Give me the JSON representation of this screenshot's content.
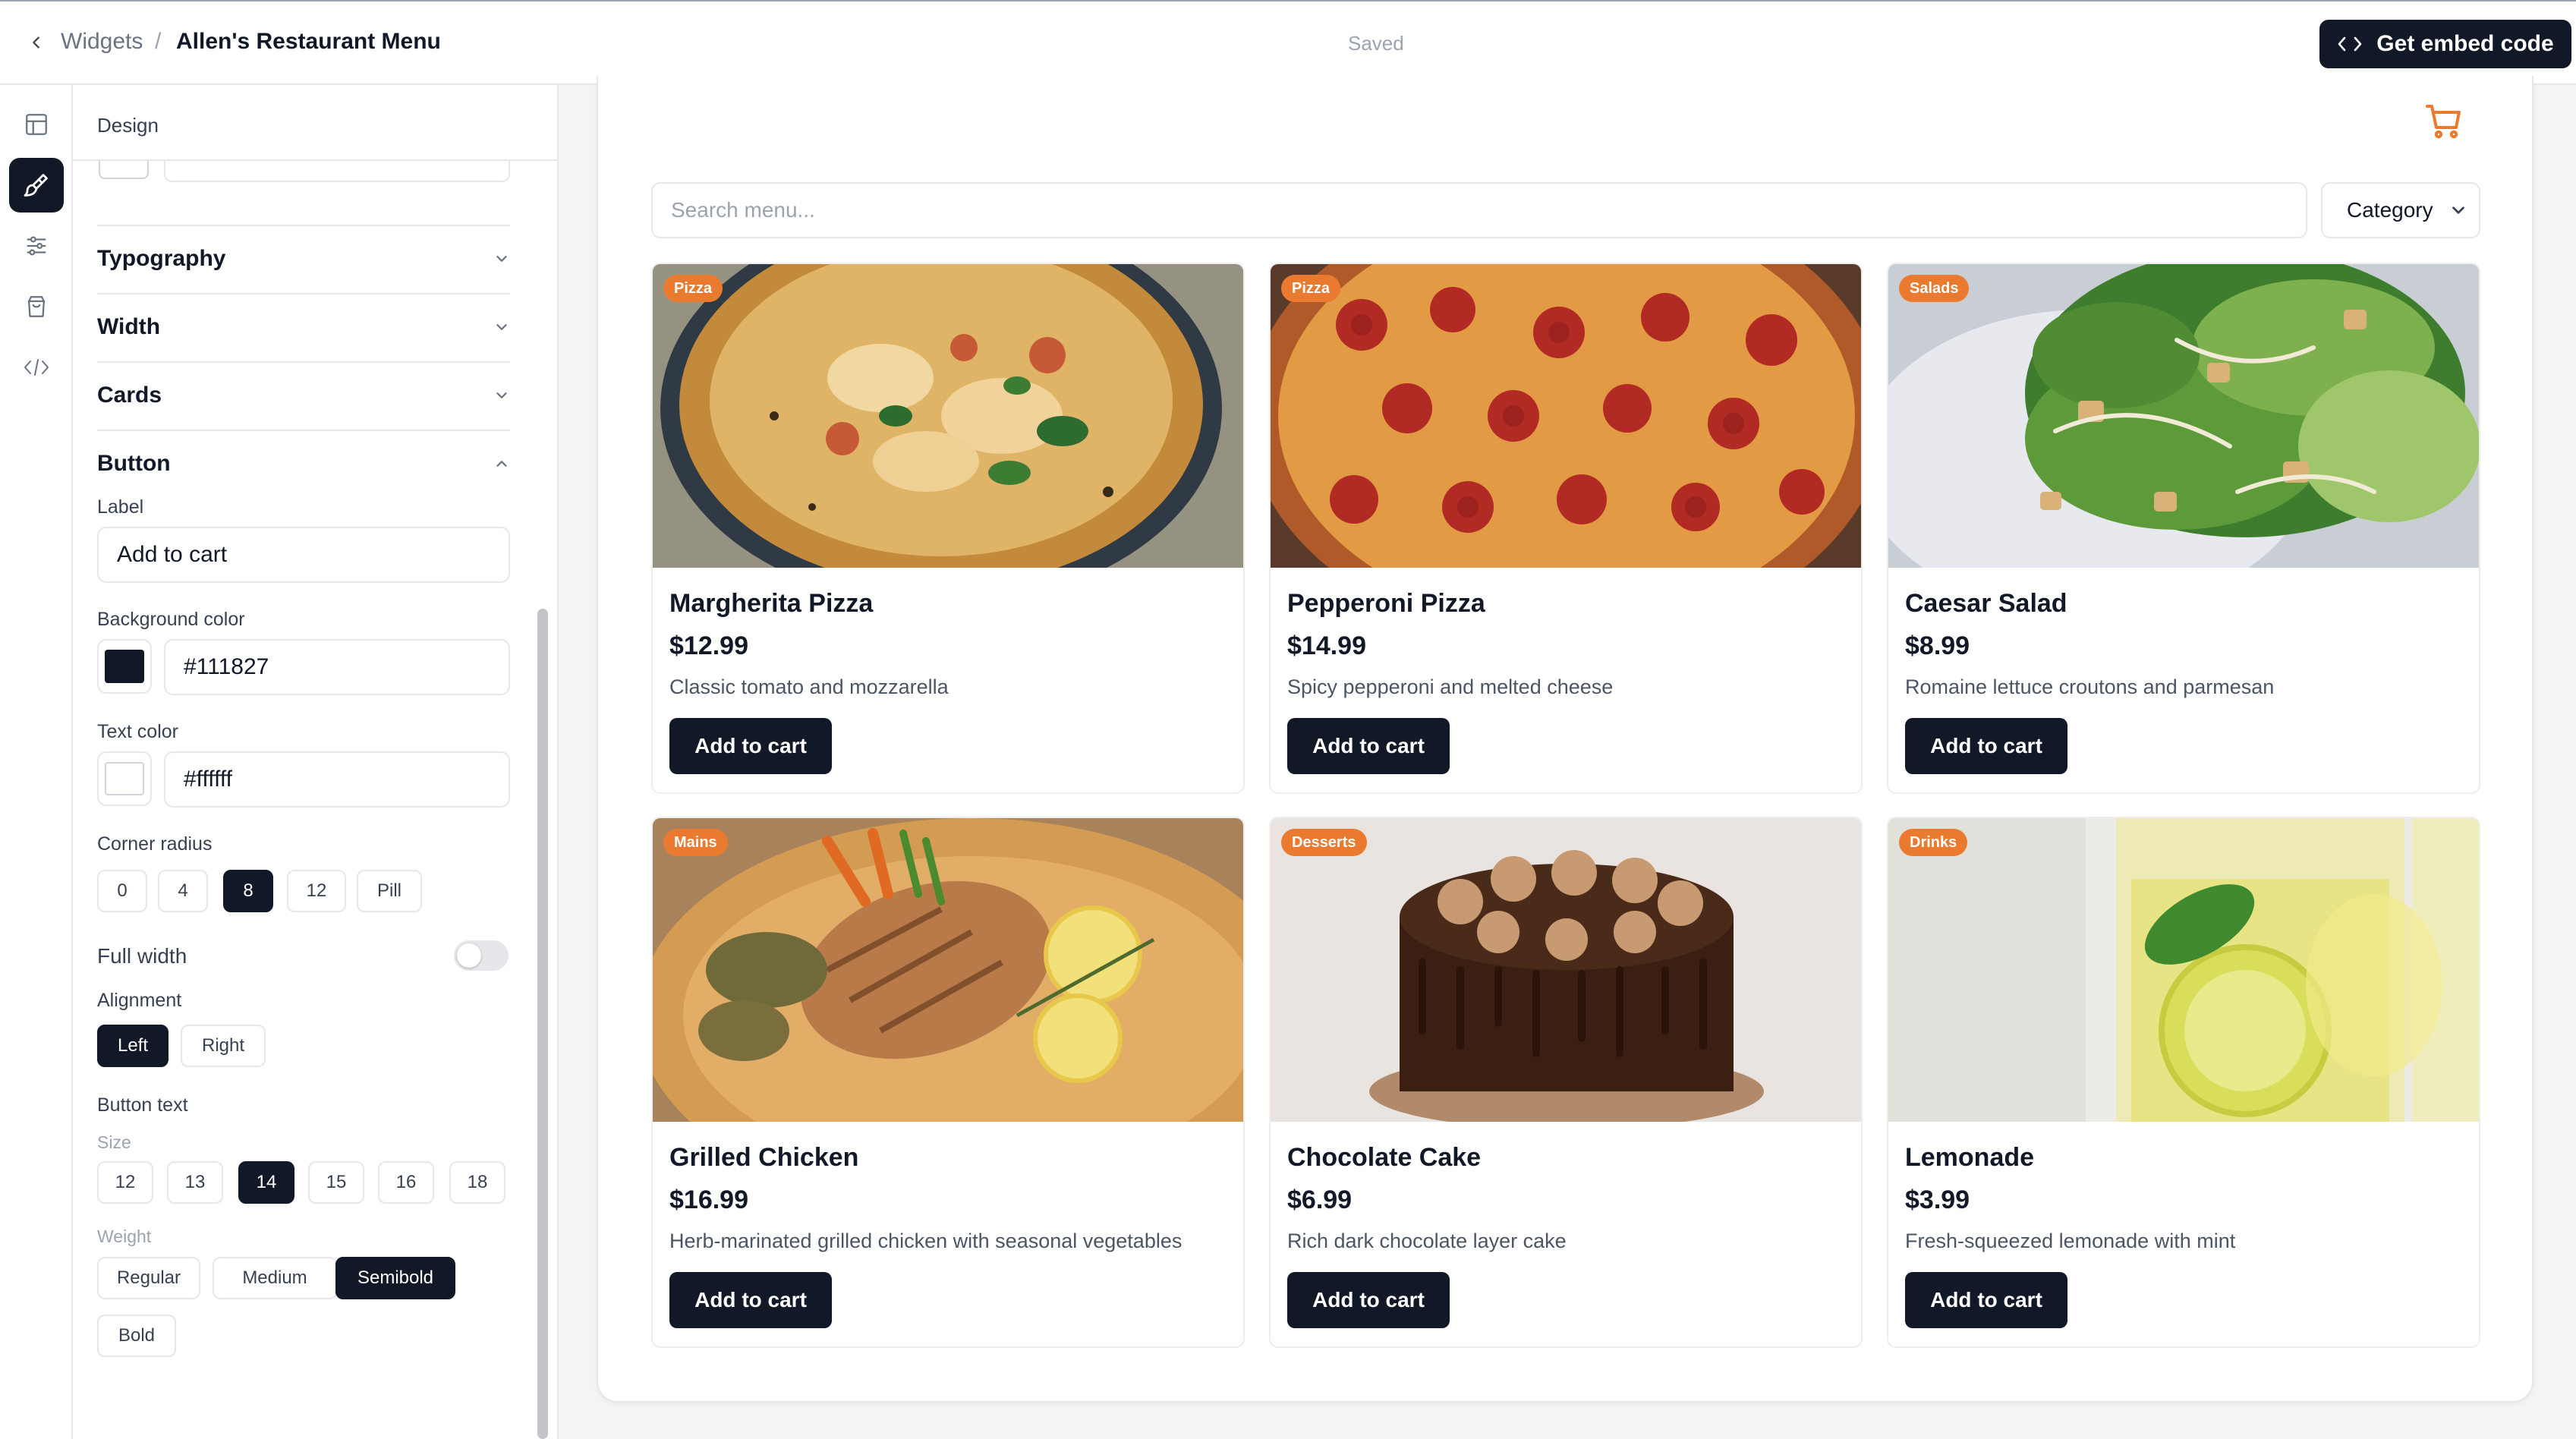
{
  "colors": {
    "accent": "#ea7a2f",
    "button_bg": "#111827",
    "button_text": "#ffffff"
  },
  "topbar": {
    "back_icon": "chevron-left-icon",
    "breadcrumb_parent": "Widgets",
    "breadcrumb_separator": "/",
    "breadcrumb_current": "Allen's Restaurant Menu",
    "status": "Saved",
    "embed_button": "Get embed code",
    "embed_icon": "code-icon"
  },
  "rail": {
    "items": [
      {
        "icon": "layout-icon",
        "active": false
      },
      {
        "icon": "paintbrush-icon",
        "active": true
      },
      {
        "icon": "sliders-icon",
        "active": false
      },
      {
        "icon": "shopping-bag-icon",
        "active": false
      },
      {
        "icon": "code-icon",
        "active": false
      }
    ]
  },
  "panel": {
    "title": "Design",
    "sections": {
      "typography": "Typography",
      "width": "Width",
      "cards": "Cards",
      "button": "Button"
    },
    "button": {
      "label_title": "Label",
      "label_value": "Add to cart",
      "bg_title": "Background color",
      "bg_value": "#111827",
      "text_color_title": "Text color",
      "text_color_value": "#ffffff",
      "radius_title": "Corner radius",
      "radius_options": [
        "0",
        "4",
        "8",
        "12",
        "Pill"
      ],
      "radius_selected": "8",
      "full_width_title": "Full width",
      "full_width_on": false,
      "alignment_title": "Alignment",
      "alignment_options": [
        "Left",
        "Right"
      ],
      "alignment_selected": "Left",
      "button_text_title": "Button text",
      "size_title": "Size",
      "size_options": [
        "12",
        "13",
        "14",
        "15",
        "16",
        "18"
      ],
      "size_selected": "14",
      "weight_title": "Weight",
      "weight_options": [
        "Regular",
        "Medium",
        "Semibold",
        "Bold"
      ],
      "weight_selected": "Semibold"
    }
  },
  "preview": {
    "cart_icon": "shopping-cart-icon",
    "search_placeholder": "Search menu...",
    "category_label": "Category",
    "button_label": "Add to cart",
    "items": [
      {
        "category": "Pizza",
        "name": "Margherita Pizza",
        "price": "$12.99",
        "description": "Classic tomato and mozzarella",
        "image": "margherita-pizza-photo"
      },
      {
        "category": "Pizza",
        "name": "Pepperoni Pizza",
        "price": "$14.99",
        "description": "Spicy pepperoni and melted cheese",
        "image": "pepperoni-pizza-photo"
      },
      {
        "category": "Salads",
        "name": "Caesar Salad",
        "price": "$8.99",
        "description": "Romaine lettuce croutons and parmesan",
        "image": "caesar-salad-photo"
      },
      {
        "category": "Mains",
        "name": "Grilled Chicken",
        "price": "$16.99",
        "description": "Herb-marinated grilled chicken with seasonal vegetables",
        "image": "grilled-chicken-photo"
      },
      {
        "category": "Desserts",
        "name": "Chocolate Cake",
        "price": "$6.99",
        "description": "Rich dark chocolate layer cake",
        "image": "chocolate-cake-photo"
      },
      {
        "category": "Drinks",
        "name": "Lemonade",
        "price": "$3.99",
        "description": "Fresh-squeezed lemonade with mint",
        "image": "lemonade-photo"
      }
    ]
  }
}
